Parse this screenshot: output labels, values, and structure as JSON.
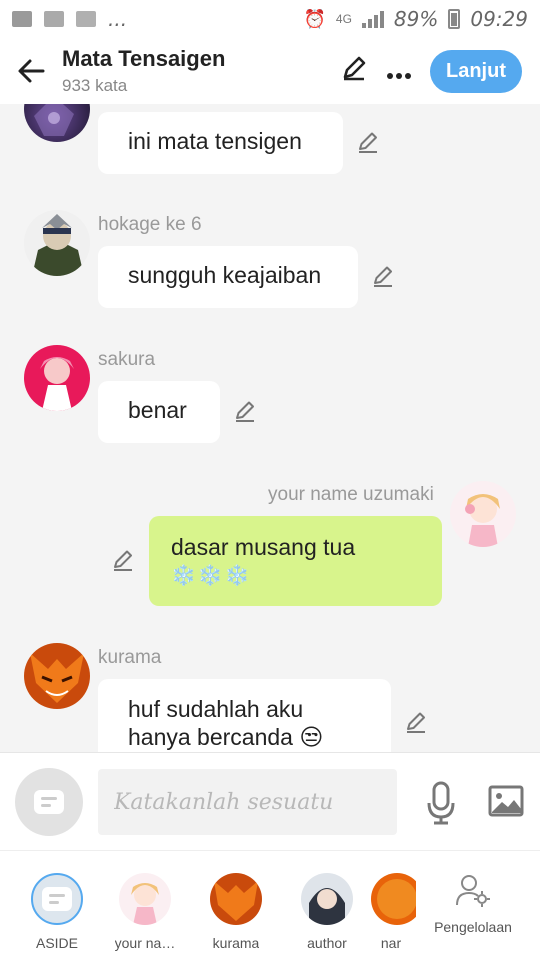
{
  "status_bar": {
    "dots": "...",
    "network": "4G",
    "battery": "89%",
    "time": "09:29"
  },
  "header": {
    "back_icon": "arrow-left-icon",
    "title": "Mata Tensaigen",
    "subtitle": "933 kata",
    "next_label": "Lanjut"
  },
  "messages": [
    {
      "sender": "",
      "text": "ini mata tensigen",
      "mine": false
    },
    {
      "sender": "hokage ke 6",
      "text": "sungguh keajaiban",
      "mine": false
    },
    {
      "sender": "sakura",
      "text": "benar",
      "mine": false
    },
    {
      "sender": "your name uzumaki",
      "text": "dasar musang tua",
      "extra": "❄️❄️❄️",
      "mine": true
    },
    {
      "sender": "kurama",
      "text": "huf sudahlah aku",
      "text2": "hanya bercanda 😒",
      "mine": false
    }
  ],
  "input": {
    "placeholder": "Katakanlah sesuatu"
  },
  "characters": [
    {
      "label": "ASIDE",
      "selected": true
    },
    {
      "label": "your na…"
    },
    {
      "label": "kurama"
    },
    {
      "label": "author"
    },
    {
      "label": "nar"
    }
  ],
  "manage_label": "Pengelolaan",
  "colors": {
    "accent": "#55a9ef",
    "mine_bubble": "#d8f48c",
    "background": "#f4f4f4"
  }
}
